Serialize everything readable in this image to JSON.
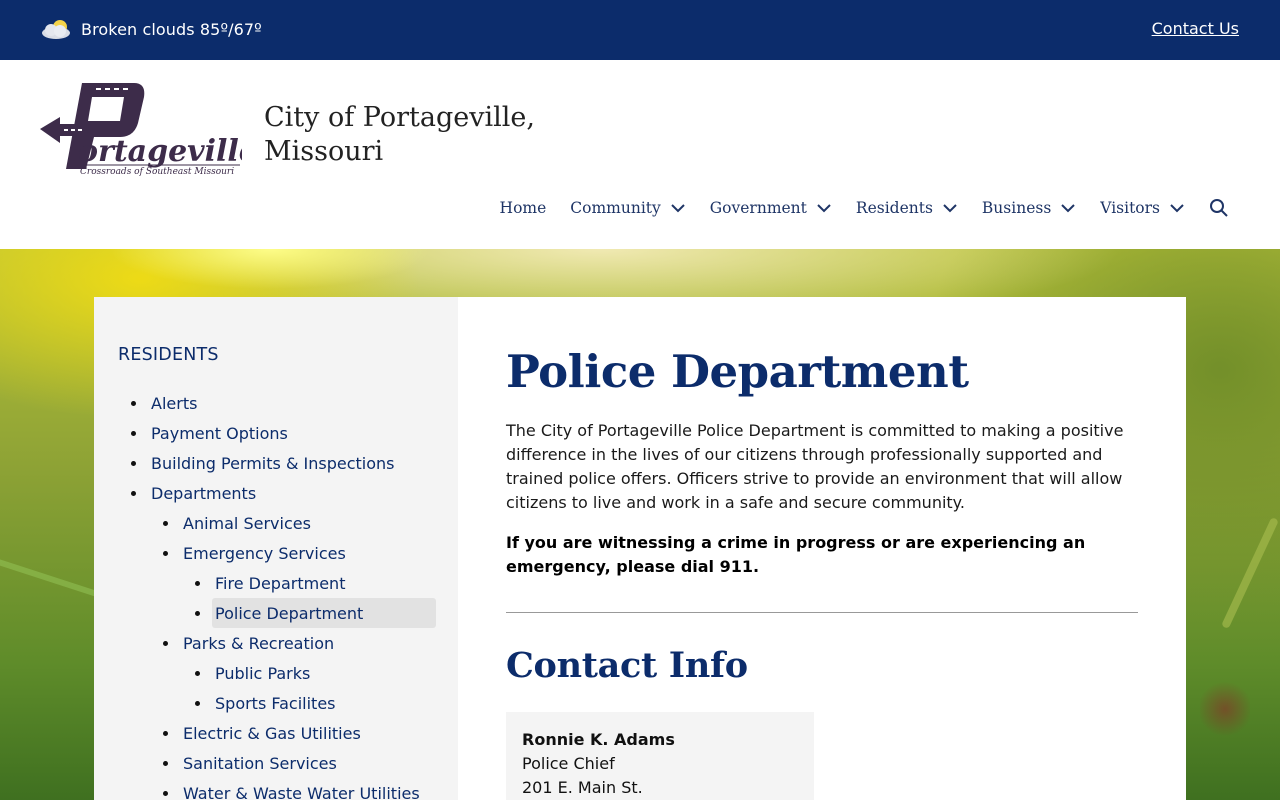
{
  "topbar": {
    "weather_icon": "cloud-icon",
    "weather_text": "Broken clouds 85º/67º",
    "contact_link": "Contact Us"
  },
  "header": {
    "logo_text": "Portageville",
    "logo_tagline": "Crossroads of Southeast Missouri",
    "site_title_line1": "City of Portageville,",
    "site_title_line2": "Missouri"
  },
  "nav": {
    "items": [
      {
        "label": "Home",
        "has_dropdown": false
      },
      {
        "label": "Community",
        "has_dropdown": true
      },
      {
        "label": "Government",
        "has_dropdown": true
      },
      {
        "label": "Residents",
        "has_dropdown": true
      },
      {
        "label": "Business",
        "has_dropdown": true
      },
      {
        "label": "Visitors",
        "has_dropdown": true
      }
    ],
    "search_icon": "search-icon"
  },
  "sidebar": {
    "heading": "RESIDENTS",
    "items": [
      {
        "label": "Alerts",
        "level": 1
      },
      {
        "label": "Payment Options",
        "level": 1
      },
      {
        "label": "Building Permits & Inspections",
        "level": 1
      },
      {
        "label": "Departments",
        "level": 1
      },
      {
        "label": "Animal Services",
        "level": 2
      },
      {
        "label": "Emergency Services",
        "level": 2
      },
      {
        "label": "Fire Department",
        "level": 3
      },
      {
        "label": "Police Department",
        "level": 3,
        "active": true
      },
      {
        "label": "Parks & Recreation",
        "level": 2
      },
      {
        "label": "Public Parks",
        "level": 3
      },
      {
        "label": "Sports Facilites",
        "level": 3
      },
      {
        "label": "Electric & Gas Utilities",
        "level": 2
      },
      {
        "label": "Sanitation Services",
        "level": 2
      },
      {
        "label": "Water & Waste Water Utilities",
        "level": 2
      }
    ]
  },
  "main": {
    "title": "Police Department",
    "intro": "The City of Portageville Police Department is committed to making a positive difference in the lives of our citizens through professionally supported and trained police offers. Officers strive to provide an environment that will allow citizens to live and work in a safe and secure community.",
    "emergency": "If you are witnessing a crime in progress or are experiencing an emergency, please dial 911.",
    "contact_heading": "Contact Info",
    "contact": {
      "name": "Ronnie K. Adams",
      "role": "Police Chief",
      "address": "201 E. Main St."
    }
  },
  "colors": {
    "brand_navy": "#0c2c6b",
    "logo_purple": "#3d2c4a",
    "sidebar_bg": "#f4f4f4"
  }
}
